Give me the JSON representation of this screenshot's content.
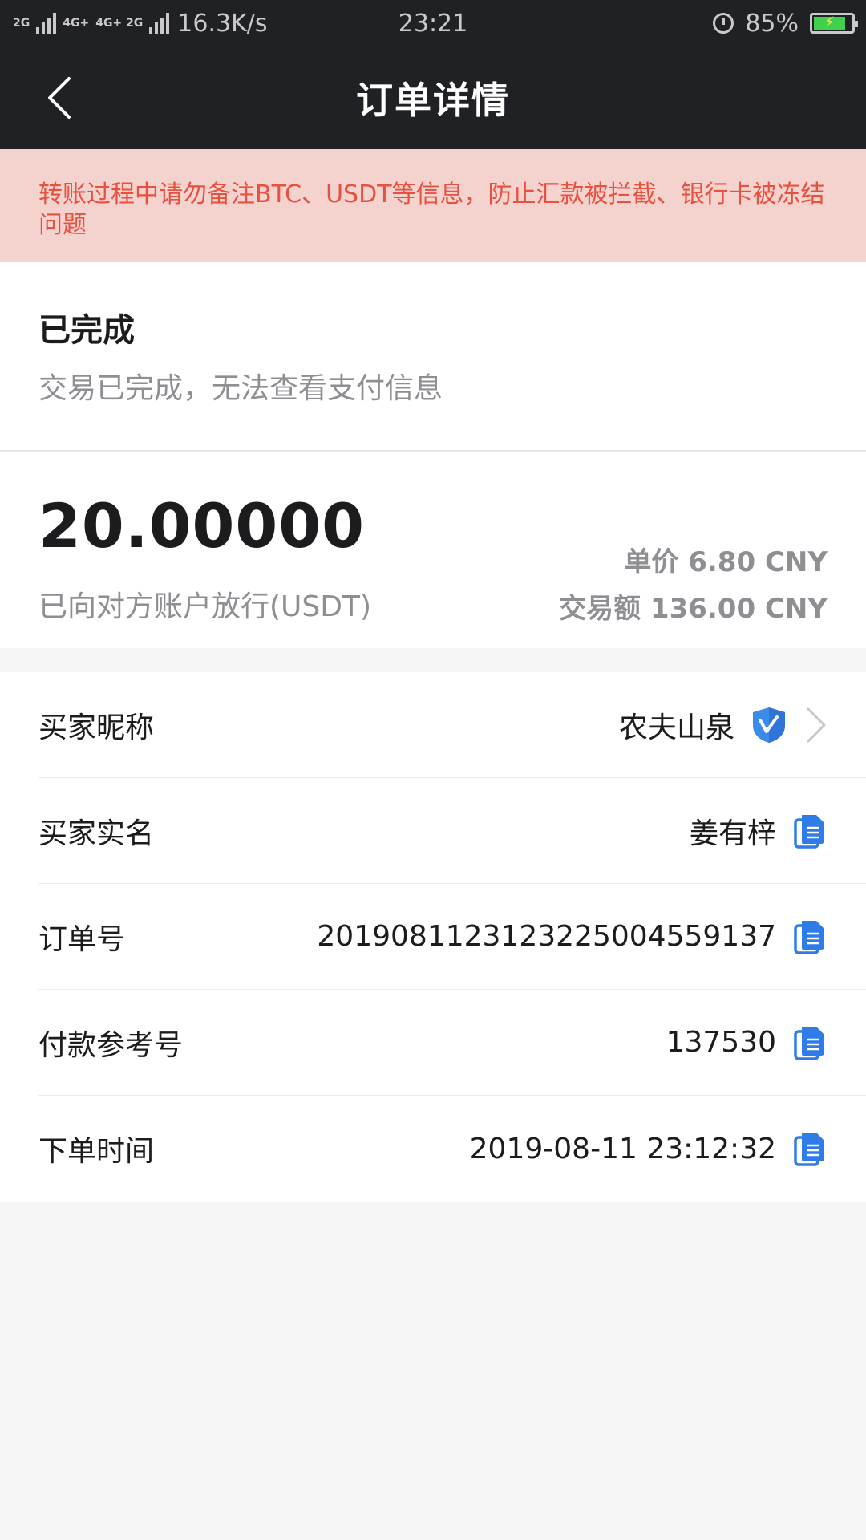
{
  "status_bar": {
    "network_1": "2G",
    "network_2": "4G+",
    "network_3": "4G+ 2G",
    "speed": "16.3K/s",
    "time": "23:21",
    "battery_percent": "85%",
    "battery_level": 0.85
  },
  "nav": {
    "title": "订单详情"
  },
  "warning": {
    "text": "转账过程中请勿备注BTC、USDT等信息，防止汇款被拦截、银行卡被冻结问题"
  },
  "order_status": {
    "title": "已完成",
    "subtitle": "交易已完成，无法查看支付信息"
  },
  "amount": {
    "value": "20.00000",
    "label": "已向对方账户放行(USDT)",
    "unit_price_label": "单价",
    "unit_price": "6.80 CNY",
    "total_label": "交易额",
    "total": "136.00 CNY"
  },
  "details": [
    {
      "label": "买家昵称",
      "value": "农夫山泉",
      "action": "chevron-right-icon"
    },
    {
      "label": "买家实名",
      "value": "姜有梓",
      "action": "copy-icon"
    },
    {
      "label": "订单号",
      "value": "2019081123123225004559137",
      "action": "copy-icon"
    },
    {
      "label": "付款参考号",
      "value": "137530",
      "action": "copy-icon"
    },
    {
      "label": "下单时间",
      "value": "2019-08-11 23:12:32",
      "action": "copy-icon"
    }
  ],
  "colors": {
    "dark_header": "#202125",
    "warning_bg": "#f4d3cf",
    "warning_text": "#e8503f",
    "accent_blue": "#2f7be8"
  }
}
